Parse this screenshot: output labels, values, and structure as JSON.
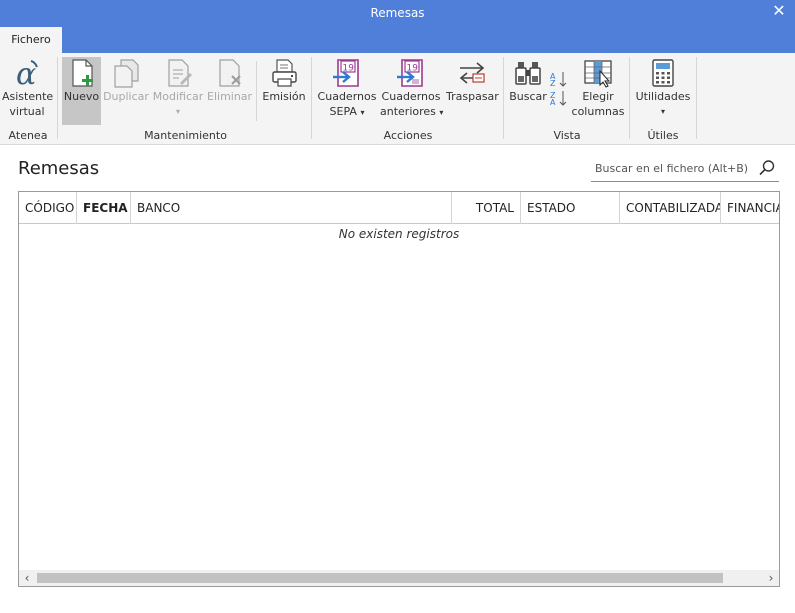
{
  "window": {
    "title": "Remesas"
  },
  "tabs": [
    {
      "label": "Fichero"
    }
  ],
  "ribbon": {
    "atenea": {
      "group": "Atenea",
      "asistente": [
        "Asistente",
        "virtual"
      ]
    },
    "mantenimiento": {
      "group": "Mantenimiento",
      "nuevo": "Nuevo",
      "duplicar": "Duplicar",
      "modificar": "Modificar",
      "eliminar": "Eliminar",
      "emision": "Emisión"
    },
    "acciones": {
      "group": "Acciones",
      "cuadernos_sepa": [
        "Cuadernos",
        "SEPA"
      ],
      "cuadernos_anteriores": [
        "Cuadernos",
        "anteriores"
      ],
      "traspasar": "Traspasar"
    },
    "vista": {
      "group": "Vista",
      "buscar": "Buscar",
      "elegir_columnas": [
        "Elegir",
        "columnas"
      ]
    },
    "utiles": {
      "group": "Útiles",
      "utilidades": "Utilidades"
    }
  },
  "page": {
    "title": "Remesas"
  },
  "search": {
    "placeholder": "Buscar en el fichero (Alt+B)"
  },
  "table": {
    "columns": [
      "CÓDIGO",
      "FECHA",
      "BANCO",
      "TOTAL",
      "ESTADO",
      "CONTABILIZADA",
      "FINANCIADA"
    ],
    "empty_message": "No existen registros"
  },
  "colors": {
    "titlebar": "#4f7fd9",
    "ribbon": "#f4f4f4",
    "sepa_purple": "#9b3a8f",
    "accent_blue": "#2a7bd1",
    "nuevo_green": "#2e9a42"
  },
  "icons": {
    "close": "close-icon",
    "asistente": "alpha-icon",
    "nuevo": "new-document-icon",
    "duplicar": "duplicate-icon",
    "modificar": "edit-document-icon",
    "eliminar": "delete-document-icon",
    "emision": "printer-icon",
    "sepa": "sepa-19-icon",
    "anteriores": "sepa-19-old-icon",
    "traspasar": "transfer-icon",
    "buscar": "binoculars-icon",
    "sort": "sort-az-icon",
    "columnas": "choose-columns-icon",
    "utilidades": "calculator-icon",
    "search": "search-icon"
  }
}
